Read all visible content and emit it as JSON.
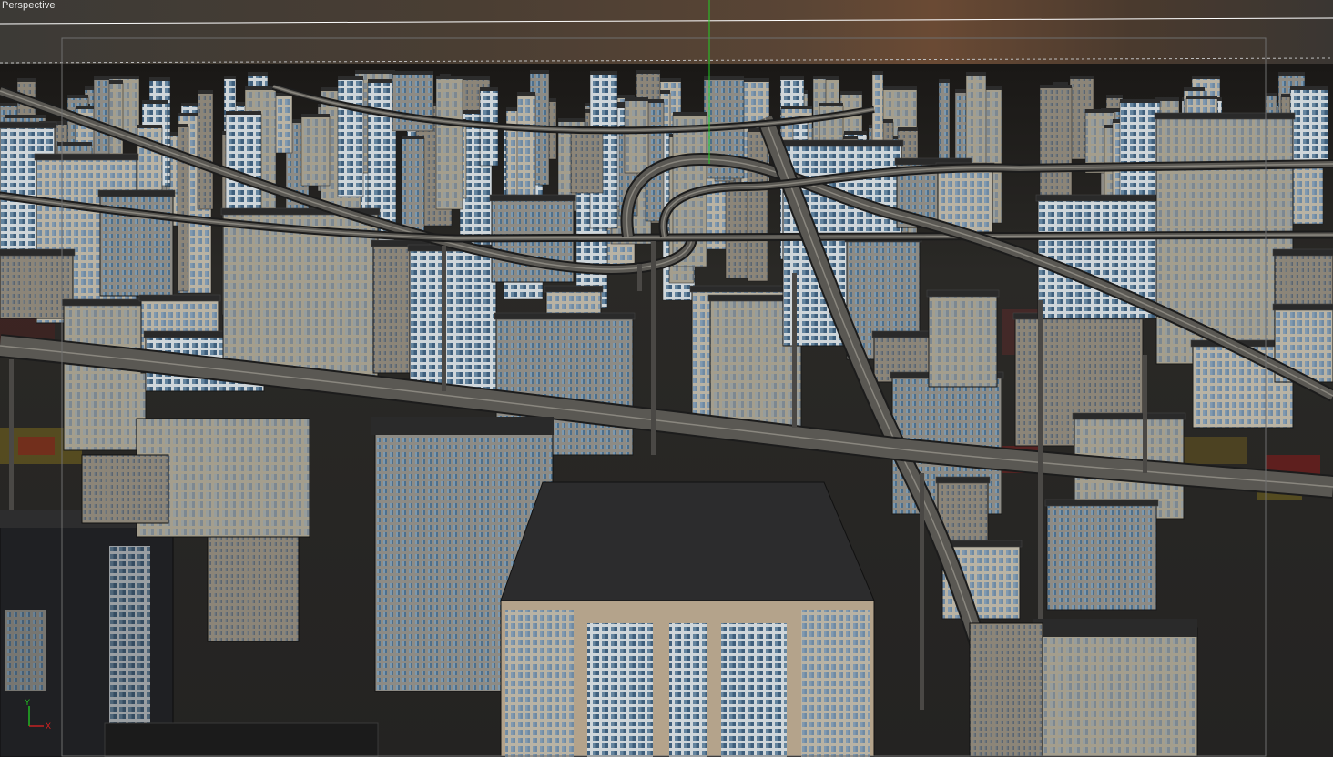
{
  "viewport": {
    "label": "Perspective"
  },
  "axis_gizmo": {
    "y": "Y",
    "x": "X"
  },
  "colors": {
    "grid_line": "#ffffff",
    "y_axis": "#22cc22",
    "safe_frame": "#bdbdbd",
    "x_axis": "#dd2222"
  }
}
